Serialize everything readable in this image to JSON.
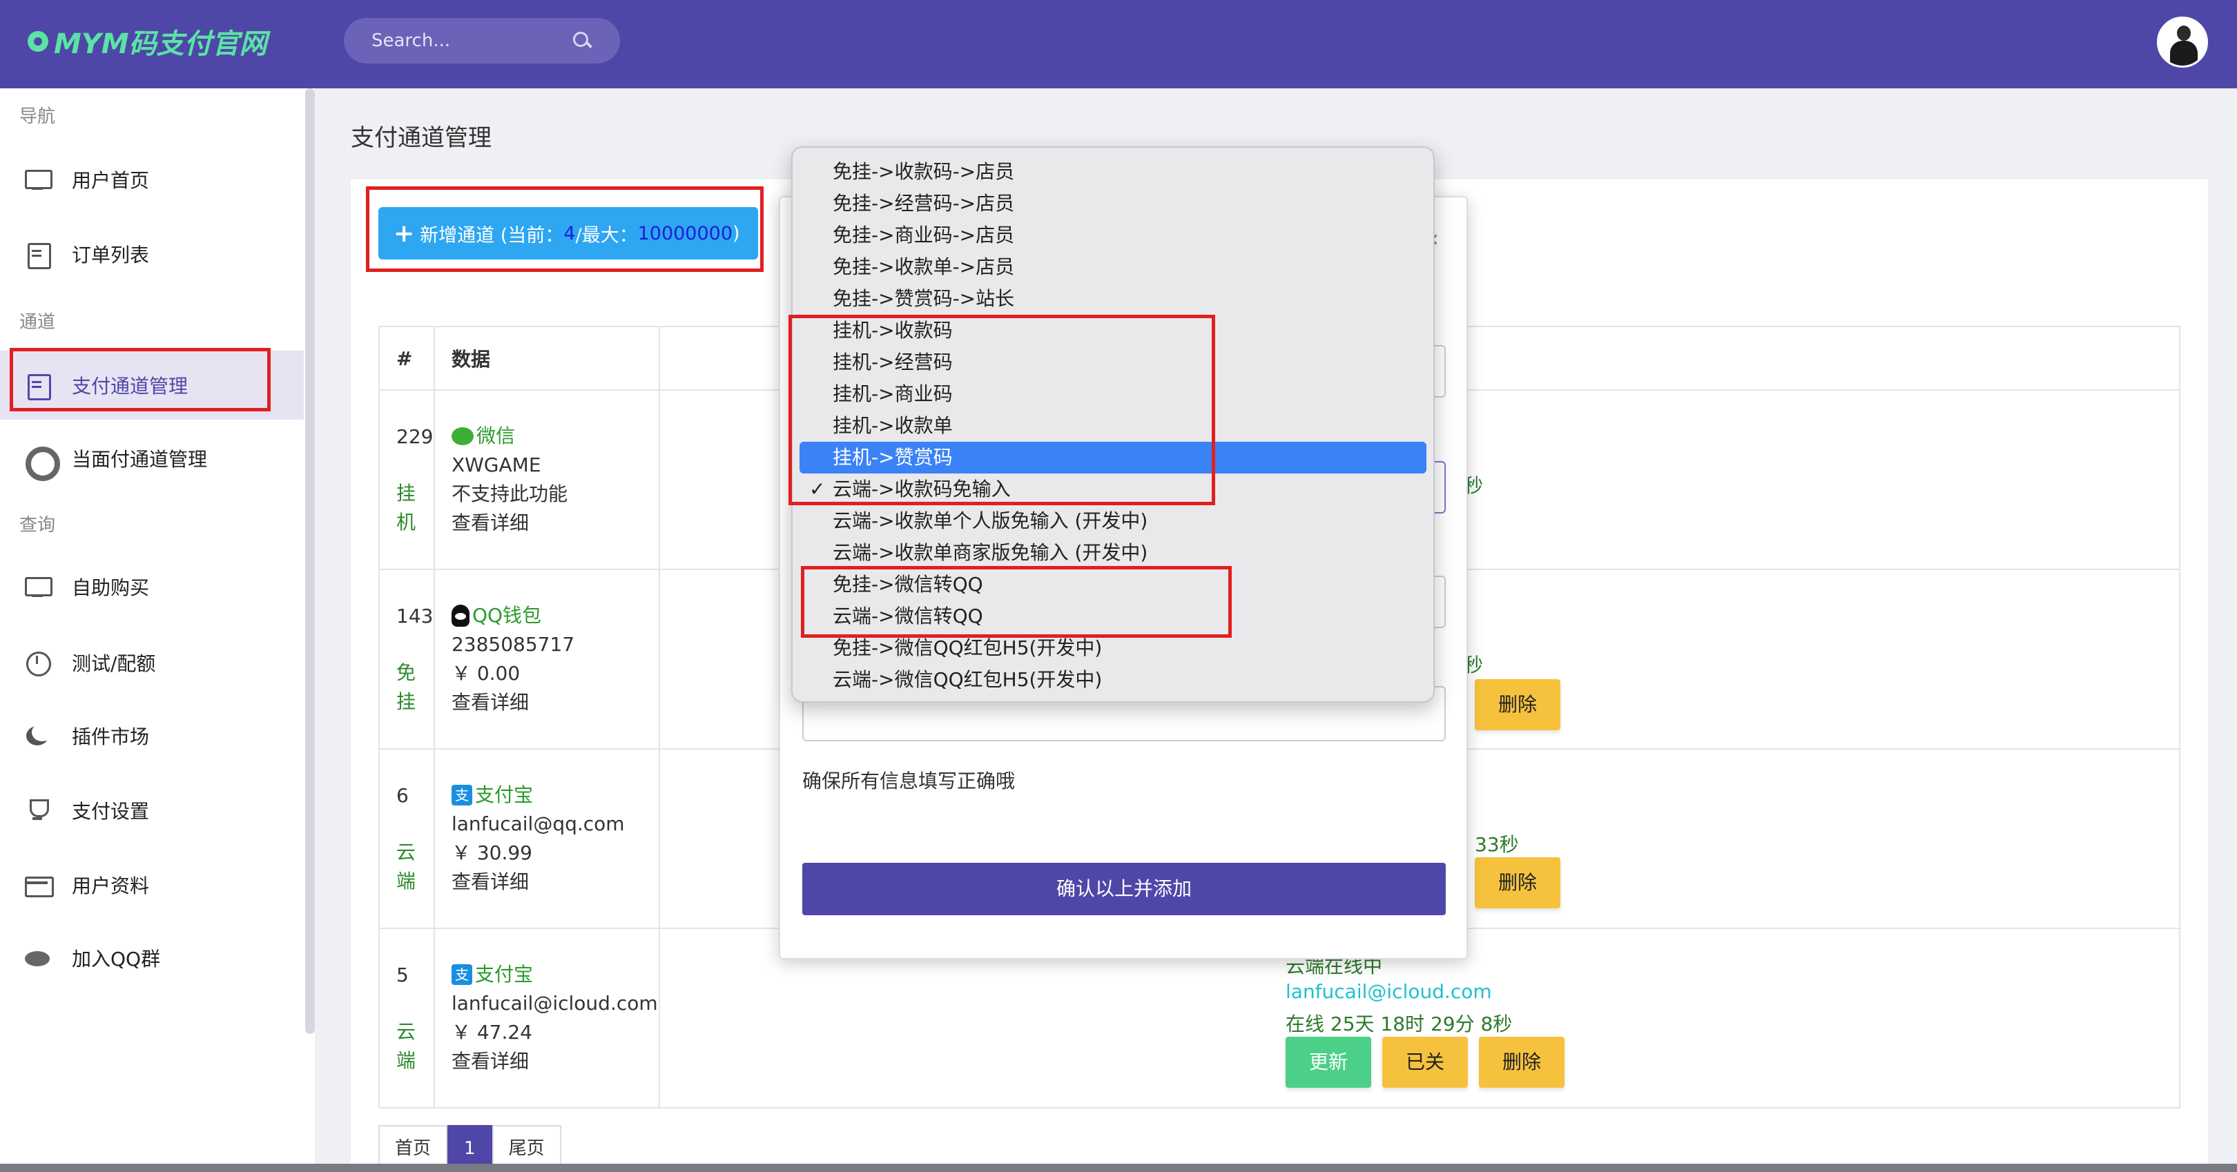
{
  "app": {
    "logo_text": "MYM码支付官网"
  },
  "search": {
    "placeholder": "Search..."
  },
  "sidebar": {
    "sections": [
      "导航",
      "通道",
      "查询"
    ],
    "items": [
      {
        "label": "用户首页",
        "icon": "monitor-icon"
      },
      {
        "label": "订单列表",
        "icon": "document-icon"
      },
      {
        "label": "支付通道管理",
        "icon": "document-icon"
      },
      {
        "label": "当面付通道管理",
        "icon": "lifebuoy-icon"
      },
      {
        "label": "自助购买",
        "icon": "monitor-icon"
      },
      {
        "label": "测试/配额",
        "icon": "clock-icon"
      },
      {
        "label": "插件市场",
        "icon": "moon-icon"
      },
      {
        "label": "支付设置",
        "icon": "trophy-icon"
      },
      {
        "label": "用户资料",
        "icon": "card-icon"
      },
      {
        "label": "加入QQ群",
        "icon": "database-icon"
      }
    ]
  },
  "page": {
    "title": "支付通道管理",
    "add_button": {
      "prefix": "新增通道 (当前：",
      "current": "4",
      "middle": "/最大：",
      "max": "10000000",
      "suffix": ")"
    }
  },
  "table": {
    "headers": [
      "#",
      "数据"
    ],
    "rows": [
      {
        "id": "229",
        "type": "挂机",
        "channel": "微信",
        "account": "XWGAME",
        "line3": "不支持此功能",
        "detail": "查看详细",
        "status_tail": "秒"
      },
      {
        "id": "143",
        "type": "免挂",
        "channel": "QQ钱包",
        "account": "2385085717",
        "line3": "￥ 0.00",
        "detail": "查看详细",
        "status_tail": "秒",
        "btn": "删除"
      },
      {
        "id": "6",
        "type": "云端",
        "channel": "支付宝",
        "account": "lanfucail@qq.com",
        "line3": "￥ 30.99",
        "detail": "查看详细",
        "status_tail": "33秒",
        "btn": "删除"
      },
      {
        "id": "5",
        "type": "云端",
        "channel": "支付宝",
        "account": "lanfucail@icloud.com",
        "line3": "￥ 47.24",
        "detail": "查看详细",
        "status_title": "云端在线中",
        "status_email": "lanfucail@icloud.com",
        "status_time": "在线 25天 18时 29分 8秒",
        "btn_update": "更新",
        "btn_off": "已关",
        "btn_delete": "删除"
      }
    ]
  },
  "pager": {
    "first": "首页",
    "current": "1",
    "last": "尾页"
  },
  "modal": {
    "note": "确保所有信息填写正确哦",
    "confirm": "确认以上并添加"
  },
  "dropdown": {
    "options": [
      "免挂->收款码->店员",
      "免挂->经营码->店员",
      "免挂->商业码->店员",
      "免挂->收款单->店员",
      "免挂->赞赏码->站长",
      "挂机->收款码",
      "挂机->经营码",
      "挂机->商业码",
      "挂机->收款单",
      "挂机->赞赏码",
      "云端->收款码免输入",
      "云端->收款单个人版免输入 (开发中)",
      "云端->收款单商家版免输入 (开发中)",
      "免挂->微信转QQ",
      "云端->微信转QQ",
      "免挂->微信QQ红包H5(开发中)",
      "云端->微信QQ红包H5(开发中)"
    ],
    "highlighted_index": 9,
    "checked_index": 10,
    "checkmark": "✓"
  },
  "colors": {
    "header": "#4f47a8",
    "accent_green": "#5be3a4",
    "annotation_red": "#e02020"
  }
}
